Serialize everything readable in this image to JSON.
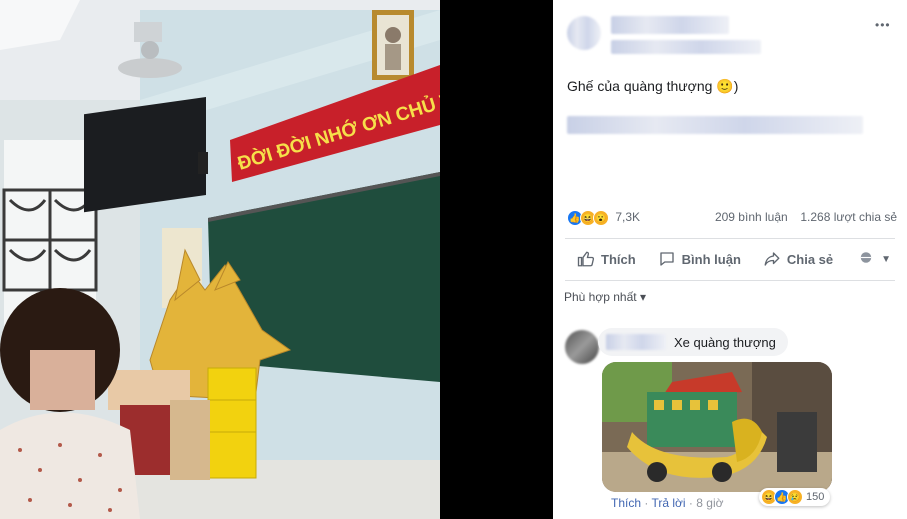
{
  "photo": {
    "banner_text": "ĐỜI ĐỜI NHỚ ƠN CHỦ TỊCH H",
    "portrait": "portrait-of-leader"
  },
  "post": {
    "author_name": "",
    "caption": "Ghế của quàng thượng",
    "caption_emoji": "🙂",
    "caption_suffix": ")",
    "more_icon": "•••",
    "reactions": {
      "count": "7,3K",
      "icons": [
        "like-icon",
        "haha-icon",
        "wow-icon"
      ]
    },
    "comments_count": "209 bình luận",
    "shares_count": "1.268 lượt chia sẻ",
    "actions": {
      "like": "Thích",
      "comment": "Bình luận",
      "share": "Chia sẻ"
    },
    "sort_label": "Phù hợp nhất",
    "sort_caret": "▾"
  },
  "comment": {
    "text": "Xe quàng thượng",
    "image_desc_icon": "decorated-cart-photo",
    "like": "Thích",
    "reply": "Trả lời",
    "time": "8 giờ",
    "separator": "·",
    "reaction_count": "150"
  },
  "colors": {
    "facebook_blue": "#4267b2",
    "text_primary": "#1c1e21",
    "text_secondary": "#606770",
    "banner_red": "#c8202a",
    "banner_text": "#f6e04a",
    "blackboard": "#1f4d3d"
  }
}
